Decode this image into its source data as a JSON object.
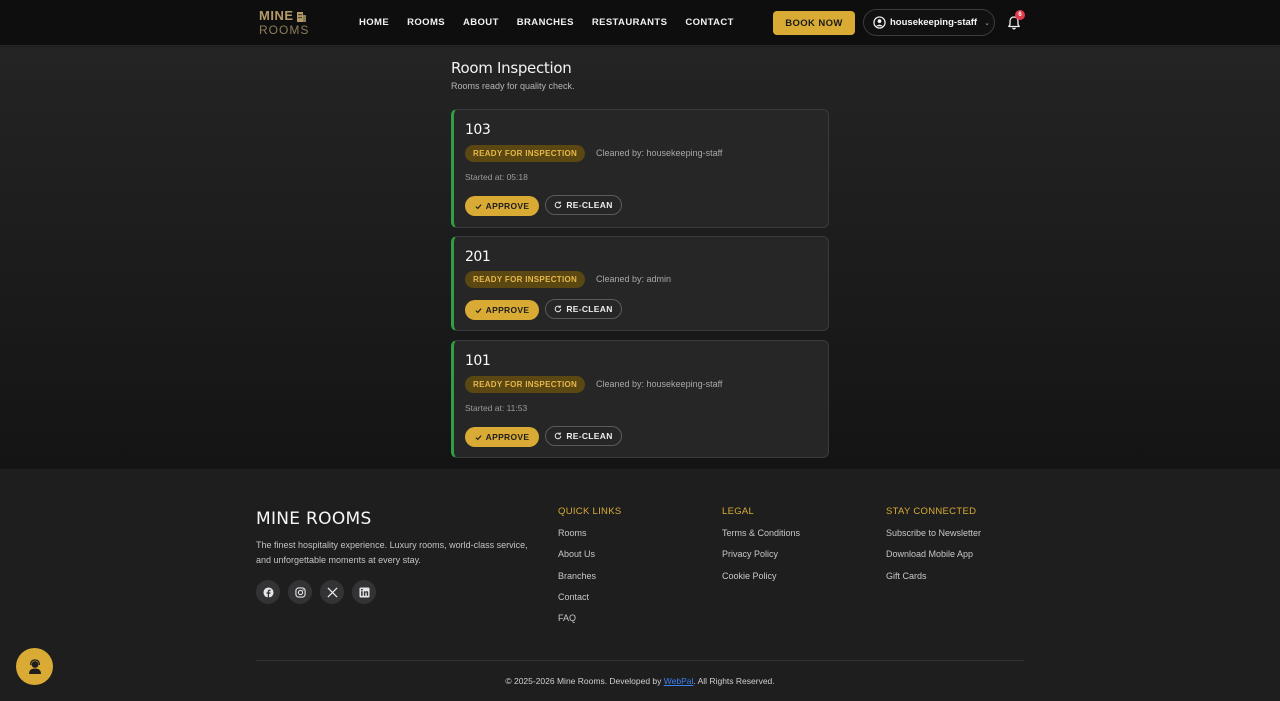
{
  "brand": {
    "line1": "MINE",
    "line2": "ROOMS"
  },
  "nav": {
    "links": [
      "HOME",
      "ROOMS",
      "ABOUT",
      "BRANCHES",
      "RESTAURANTS",
      "CONTACT"
    ],
    "book_label": "BOOK NOW",
    "user_name": "housekeeping-staff",
    "notification_count": "6"
  },
  "page": {
    "title": "Room Inspection",
    "subtitle": "Rooms ready for quality check."
  },
  "rooms": [
    {
      "number": "103",
      "status": "READY FOR INSPECTION",
      "cleaned_by": "Cleaned by: housekeeping-staff",
      "started_at": "Started at: 05:18",
      "approve": "APPROVE",
      "reclean": "RE-CLEAN"
    },
    {
      "number": "201",
      "status": "READY FOR INSPECTION",
      "cleaned_by": "Cleaned by: admin",
      "approve": "APPROVE",
      "reclean": "RE-CLEAN"
    },
    {
      "number": "101",
      "status": "READY FOR INSPECTION",
      "cleaned_by": "Cleaned by: housekeeping-staff",
      "started_at": "Started at: 11:53",
      "approve": "APPROVE",
      "reclean": "RE-CLEAN"
    }
  ],
  "footer": {
    "brand": "MINE ROOMS",
    "description": "The finest hospitality experience. Luxury rooms, world-class service, and unforgettable moments at every stay.",
    "socials": [
      "facebook-icon",
      "instagram-icon",
      "x-icon",
      "linkedin-icon"
    ],
    "quick_links": {
      "title": "QUICK LINKS",
      "items": [
        "Rooms",
        "About Us",
        "Branches",
        "Contact",
        "FAQ"
      ]
    },
    "legal": {
      "title": "LEGAL",
      "items": [
        "Terms & Conditions",
        "Privacy Policy",
        "Cookie Policy"
      ]
    },
    "stay_connected": {
      "title": "STAY CONNECTED",
      "items": [
        "Subscribe to Newsletter",
        "Download Mobile App",
        "Gift Cards"
      ]
    },
    "copyright_pre": "© 2025-2026 Mine Rooms. Developed by ",
    "copyright_link": "WebPal",
    "copyright_post": ". All Rights Reserved."
  },
  "colors": {
    "accent": "#d9ab34",
    "card_border": "#2ea043",
    "badge_bg": "#5a4712",
    "badge_text": "#e8b84a",
    "notification": "#e23b4e"
  }
}
